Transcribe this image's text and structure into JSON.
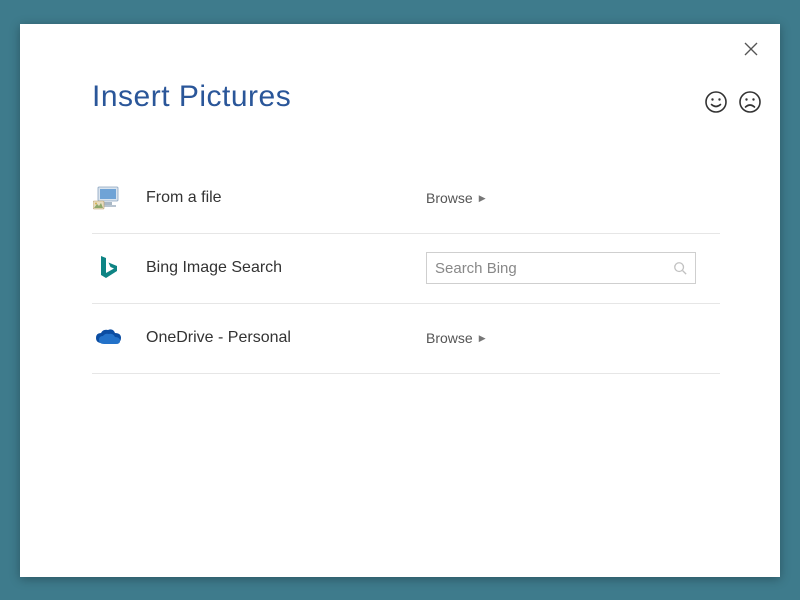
{
  "dialog": {
    "title": "Insert Pictures"
  },
  "options": {
    "file": {
      "label": "From a file",
      "action": "Browse"
    },
    "bing": {
      "label": "Bing Image Search",
      "search_placeholder": "Search Bing"
    },
    "onedrive": {
      "label": "OneDrive - Personal",
      "action": "Browse"
    }
  }
}
